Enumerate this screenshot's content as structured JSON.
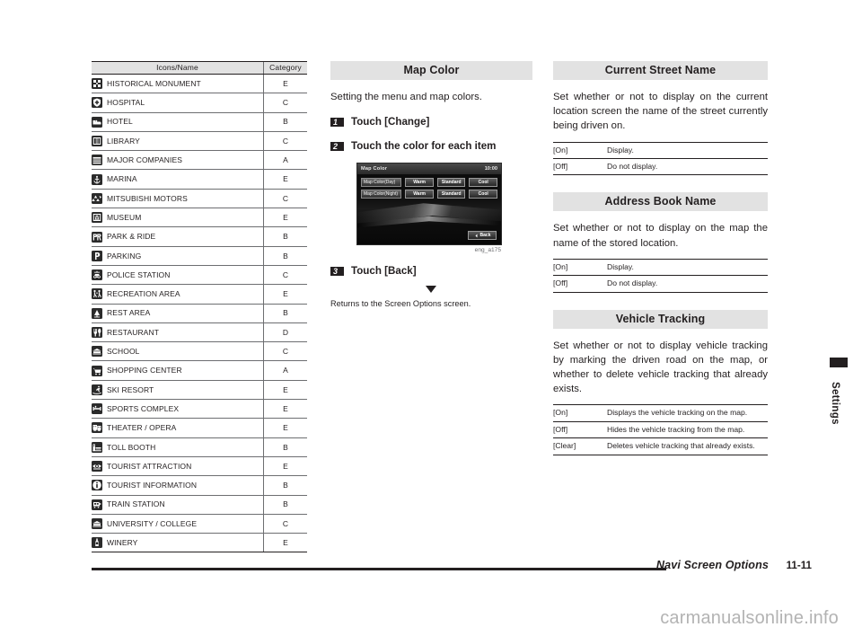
{
  "poi_table": {
    "headers": [
      "Icons/Name",
      "Category"
    ],
    "rows": [
      {
        "icon": "historical-monument-icon",
        "name": "HISTORICAL MONUMENT",
        "category": "E"
      },
      {
        "icon": "hospital-icon",
        "name": "HOSPITAL",
        "category": "C"
      },
      {
        "icon": "hotel-icon",
        "name": "HOTEL",
        "category": "B"
      },
      {
        "icon": "library-icon",
        "name": "LIBRARY",
        "category": "C"
      },
      {
        "icon": "major-companies-icon",
        "name": "MAJOR COMPANIES",
        "category": "A"
      },
      {
        "icon": "marina-icon",
        "name": "MARINA",
        "category": "E"
      },
      {
        "icon": "mitsubishi-motors-icon",
        "name": "MITSUBISHI MOTORS",
        "category": "C"
      },
      {
        "icon": "museum-icon",
        "name": "MUSEUM",
        "category": "E"
      },
      {
        "icon": "park-and-ride-icon",
        "name": "PARK & RIDE",
        "category": "B"
      },
      {
        "icon": "parking-icon",
        "name": "PARKING",
        "category": "B"
      },
      {
        "icon": "police-station-icon",
        "name": "POLICE STATION",
        "category": "C"
      },
      {
        "icon": "recreation-area-icon",
        "name": "RECREATION AREA",
        "category": "E"
      },
      {
        "icon": "rest-area-icon",
        "name": "REST AREA",
        "category": "B"
      },
      {
        "icon": "restaurant-icon",
        "name": "RESTAURANT",
        "category": "D"
      },
      {
        "icon": "school-icon",
        "name": "SCHOOL",
        "category": "C"
      },
      {
        "icon": "shopping-center-icon",
        "name": "SHOPPING CENTER",
        "category": "A"
      },
      {
        "icon": "ski-resort-icon",
        "name": "SKI RESORT",
        "category": "E"
      },
      {
        "icon": "sports-complex-icon",
        "name": "SPORTS COMPLEX",
        "category": "E"
      },
      {
        "icon": "theater-opera-icon",
        "name": "THEATER / OPERA",
        "category": "E"
      },
      {
        "icon": "toll-booth-icon",
        "name": "TOLL BOOTH",
        "category": "B"
      },
      {
        "icon": "tourist-attraction-icon",
        "name": "TOURIST ATTRACTION",
        "category": "E"
      },
      {
        "icon": "tourist-information-icon",
        "name": "TOURIST INFORMATION",
        "category": "B"
      },
      {
        "icon": "train-station-icon",
        "name": "TRAIN STATION",
        "category": "B"
      },
      {
        "icon": "university-college-icon",
        "name": "UNIVERSITY / COLLEGE",
        "category": "C"
      },
      {
        "icon": "winery-icon",
        "name": "WINERY",
        "category": "E"
      }
    ]
  },
  "map_color": {
    "title": "Map Color",
    "intro": "Setting the menu and map colors.",
    "steps": [
      {
        "num": "1",
        "text": "Touch [Change]"
      },
      {
        "num": "2",
        "text": "Touch the color for each item"
      },
      {
        "num": "3",
        "text": "Touch [Back]"
      }
    ],
    "return_text": "Returns to the Screen Options screen.",
    "caption": "eng_a175",
    "screenshot": {
      "title": "Map Color",
      "clock": "10:00",
      "rows": [
        {
          "label": "Map Color(Day)",
          "buttons": [
            "Warm",
            "Standard",
            "Cool"
          ]
        },
        {
          "label": "Map Color(Night)",
          "buttons": [
            "Warm",
            "Standard",
            "Cool"
          ]
        }
      ],
      "back_label": "Back"
    }
  },
  "current_street_name": {
    "title": "Current Street Name",
    "body": "Set whether or not to display on the current location screen the name of the street currently being driven on.",
    "options": [
      {
        "key": "[On]",
        "value": "Display."
      },
      {
        "key": "[Off]",
        "value": "Do not display."
      }
    ]
  },
  "address_book_name": {
    "title": "Address Book Name",
    "body": "Set whether or not to display on the map the name of the stored location.",
    "options": [
      {
        "key": "[On]",
        "value": "Display."
      },
      {
        "key": "[Off]",
        "value": "Do not display."
      }
    ]
  },
  "vehicle_tracking": {
    "title": "Vehicle Tracking",
    "body": "Set whether or not to display vehicle tracking by marking the driven road on the map, or whether to delete vehicle tracking that already exists.",
    "options": [
      {
        "key": "[On]",
        "value": "Displays the vehicle tracking on the map."
      },
      {
        "key": "[Off]",
        "value": "Hides the vehicle tracking from the map."
      },
      {
        "key": "[Clear]",
        "value": "Deletes vehicle tracking that already exists."
      }
    ]
  },
  "side_tab": {
    "label": "Settings"
  },
  "footer": {
    "chapter": "Navi Screen Options",
    "page": "11-11"
  },
  "watermark": "carmanualsonline.info",
  "colors": {
    "accent": "#231f20",
    "header_bg": "#e2e2e2",
    "rule": "#6d6e71"
  }
}
